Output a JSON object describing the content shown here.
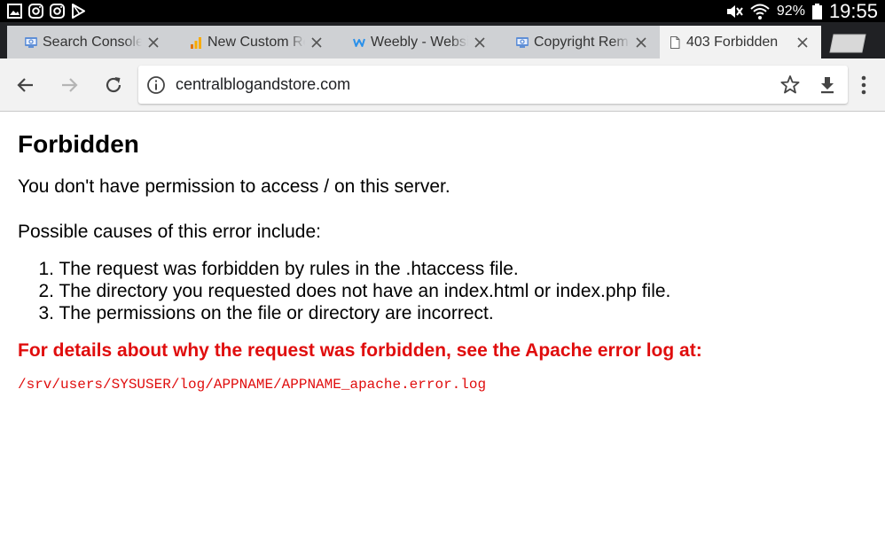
{
  "status_bar": {
    "left_icons": [
      "gallery-icon",
      "instagram-icon",
      "instagram-icon",
      "play-store-icon"
    ],
    "battery": "92%",
    "time": "19:55"
  },
  "tabs": [
    {
      "title": "Search Console - ",
      "favicon": "search-console-icon",
      "active": false
    },
    {
      "title": "New Custom Report",
      "favicon": "analytics-icon",
      "active": false
    },
    {
      "title": "Weebly - Website",
      "favicon": "weebly-icon",
      "active": false
    },
    {
      "title": "Copyright Removal",
      "favicon": "search-console-icon",
      "active": false
    },
    {
      "title": "403 Forbidden",
      "favicon": "page-icon",
      "active": true
    }
  ],
  "toolbar": {
    "url": "centralblogandstore.com"
  },
  "page": {
    "heading": "Forbidden",
    "message": "You don't have permission to access / on this server.",
    "causes_intro": "Possible causes of this error include:",
    "causes": [
      {
        "num": "1.",
        "text": "The request was forbidden by rules in the .htaccess file."
      },
      {
        "num": "2.",
        "text": "The directory you requested does not have an index.html or index.php file."
      },
      {
        "num": "3.",
        "text": "The permissions on the file or directory are incorrect."
      }
    ],
    "details": "For details about why the request was forbidden, see the Apache error log at:",
    "log_path": "/srv/users/SYSUSER/log/APPNAME/APPNAME_apache.error.log"
  },
  "colors": {
    "error_red": "#e00d0d",
    "tab_strip": "#202124",
    "toolbar": "#f2f2f2"
  }
}
